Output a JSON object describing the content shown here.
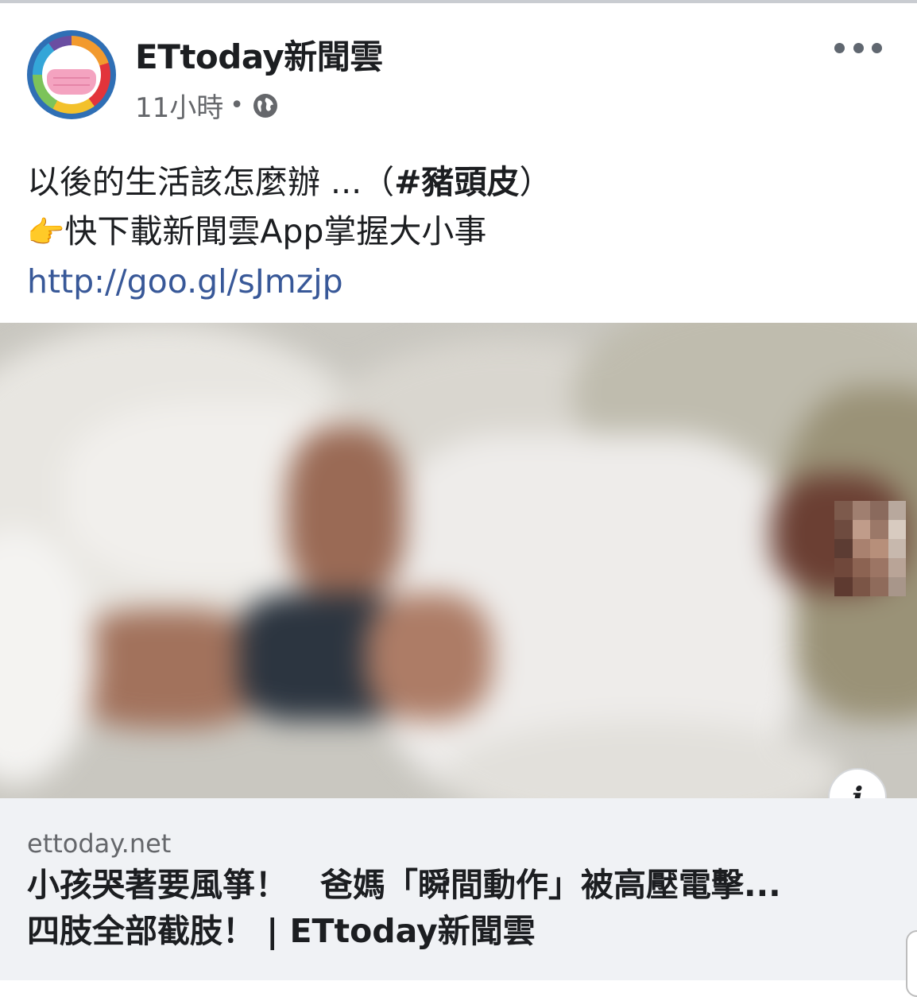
{
  "post": {
    "page_name": "ETtoday新聞雲",
    "time": "11小時",
    "separator": "•",
    "privacy_icon": "globe-icon",
    "more_icon": "more-options-icon",
    "text_line1_prefix": "以後的生活該怎麼辦 ...（",
    "hashtag": "#豬頭皮",
    "text_line1_suffix": "）",
    "text_line2_emoji": "👉",
    "text_line2": "快下載新聞雲App掌握大小事",
    "link": "http://goo.gl/sJmzjp"
  },
  "preview": {
    "domain": "ettoday.net",
    "headline_line1": "小孩哭著要風箏！　爸媽「瞬間動作」被高壓電擊...",
    "headline_line2": "四肢全部截肢！ | ETtoday新聞雲",
    "info_icon": "i"
  },
  "colors": {
    "link": "#385898",
    "secondary_text": "#65676b",
    "preview_bg": "#f0f2f5",
    "avatar_ring": "#2f6fb5"
  }
}
